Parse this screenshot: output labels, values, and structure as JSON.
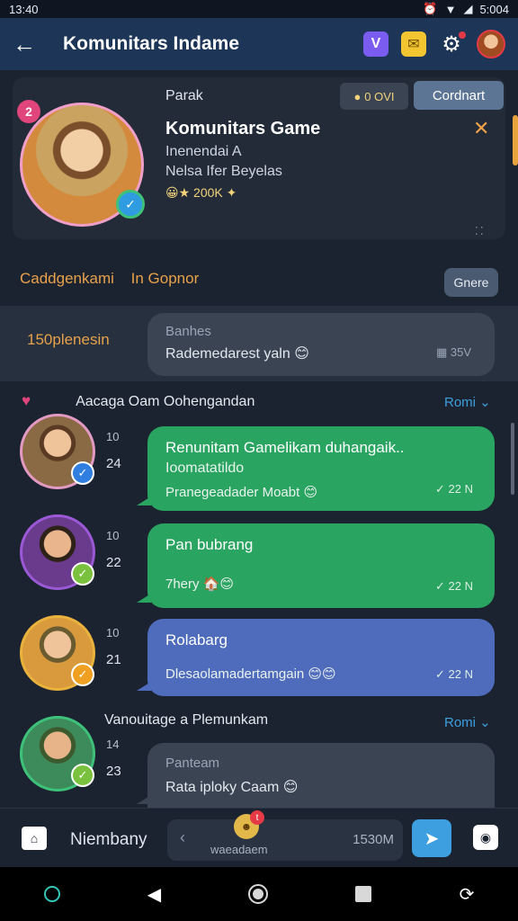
{
  "status": {
    "time": "13:40",
    "alarm_icon": "alarm-icon",
    "wifi_icon": "wifi-icon",
    "signal_icon": "signal-icon",
    "battery_text": "5:004"
  },
  "app_bar": {
    "title": "Komunitars Indame",
    "icons": [
      "purple-badge-icon",
      "mail-icon",
      "gear-icon",
      "avatar"
    ]
  },
  "profile": {
    "label": "Parak",
    "coins": "0 OVI",
    "connect_label": "Cordnart",
    "name": "Komunitars Game",
    "subtitle1": "Inenendai A",
    "subtitle2": "Nelsa Ifer Beyelas",
    "stats": "200K",
    "badge_number": "2",
    "close_label": "✕",
    "more_label": "⁚⁚"
  },
  "section": {
    "title_left": "Caddgenkami",
    "title_right": "In Gopnor",
    "create_label": "Gnere"
  },
  "promo": {
    "label": "150plenesin",
    "bubble_title": "Banhes",
    "bubble_text": "Rademedarest yaln",
    "meta": "35V"
  },
  "group1": {
    "title": "Aacaga Oam Oohengandan",
    "more_label": "Romi"
  },
  "messages": [
    {
      "time": "10",
      "day": "24",
      "title": "Renunitam Gamelikam duhangaik..",
      "line2": "Ioomatatildo",
      "line3": "Pranegeadader Moabt",
      "meta": "22 N"
    },
    {
      "time": "10",
      "day": "22",
      "title": "Pan bubrang",
      "line2": "",
      "line3": "7hery",
      "meta": "22 N"
    },
    {
      "time": "10",
      "day": "21",
      "title": "Rolabarg",
      "line2": "",
      "line3": "Dlesaolamadertamgain",
      "meta": "22 N"
    }
  ],
  "group2": {
    "title": "Vanouitage a Plemunkam",
    "more_label": "Romi"
  },
  "last_message": {
    "time": "14",
    "day": "23",
    "title": "Panteam",
    "text": "Rata iploky Caam"
  },
  "bottom": {
    "label": "Niembany",
    "input_placeholder": "waeadaem",
    "input_count": "1530M",
    "sticker_badge": "t"
  },
  "colors": {
    "app_bar": "#1d3556",
    "accent_orange": "#e9a24a",
    "bubble_green": "#2aa461",
    "bubble_blue": "#4f6cbc",
    "link_blue": "#3d9fe0"
  }
}
